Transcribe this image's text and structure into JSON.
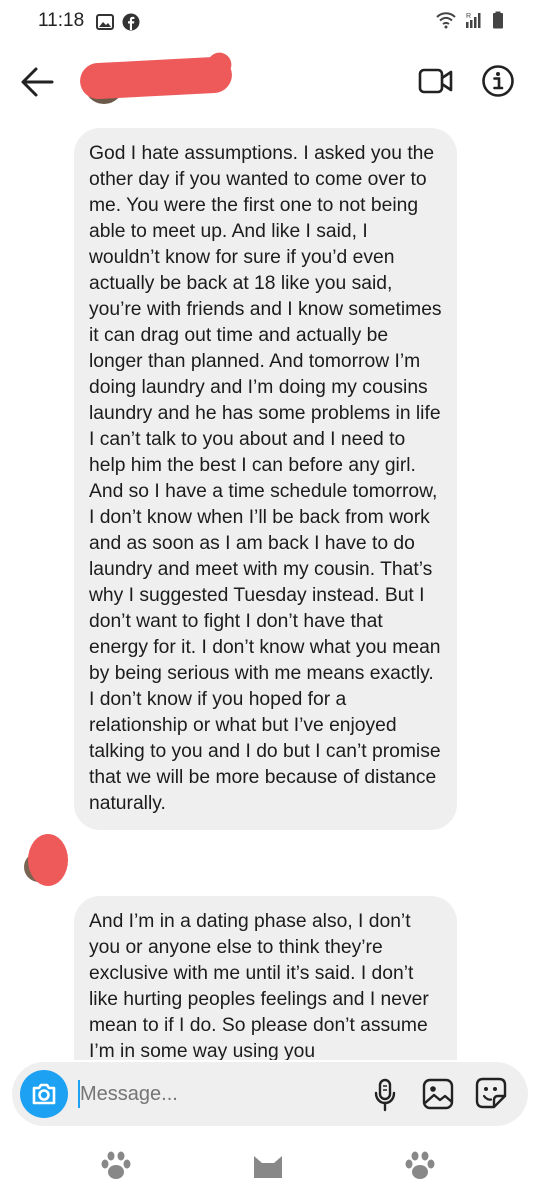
{
  "status_bar": {
    "time": "11:18",
    "left_icons": [
      "image-icon",
      "facebook-icon"
    ],
    "right_icons": [
      "wifi-icon",
      "signal-icon",
      "battery-icon"
    ]
  },
  "header": {
    "contact_name": "",
    "contact_name_redacted": true,
    "back_icon": "arrow-left-icon",
    "video_icon": "video-camera-icon",
    "info_icon": "info-icon"
  },
  "messages": [
    {
      "direction": "incoming",
      "text": "God I hate assumptions. I asked you the other day if you wanted to come over to me. You were the first one to not being able to meet up. And like I said, I wouldn’t know for sure if you’d even actually be back at 18 like you said, you’re with friends and I know sometimes it can drag out time and actually be longer than planned. And tomorrow I’m doing laundry and I’m doing my cousins laundry and he has some problems in life I can’t talk to you about and I need to help him the best I can before any girl. And so I have a time schedule tomorrow, I don’t know when I’ll be back from work and as soon as I am back I have to do laundry and meet with my cousin. That’s why I suggested Tuesday instead. But I don’t want to fight I don’t have that energy for it. I don’t know what you mean by being serious with me means exactly. I don’t know if you hoped for a relationship or what but I’ve enjoyed talking to you and I do but I can’t promise that we will be more because of distance naturally."
    },
    {
      "direction": "incoming",
      "text": "And I’m in a dating phase also, I don’t you or anyone else to think they’re exclusive with me until it’s said. I don’t like hurting peoples feelings and I never mean to if I do. So please don’t assume I’m in some way using you"
    }
  ],
  "composer": {
    "placeholder": "Message...",
    "value": "",
    "icons": [
      "camera-icon",
      "microphone-icon",
      "gallery-icon",
      "sticker-icon"
    ]
  },
  "nav": {
    "items": [
      "paw-icon",
      "cat-icon",
      "paw-icon"
    ]
  },
  "colors": {
    "accent": "#1da1f2",
    "bubble": "#efefef",
    "redaction": "#ee5a5a"
  }
}
